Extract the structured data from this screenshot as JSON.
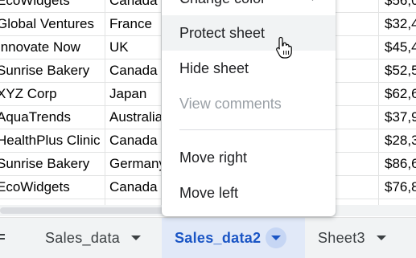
{
  "rows": [
    {
      "name": "EcoWidgets",
      "country": "Canada",
      "amount": "$56,0"
    },
    {
      "name": "Global Ventures",
      "country": "France",
      "amount": "$32,4"
    },
    {
      "name": "Innovate Now",
      "country": "UK",
      "amount": "$45,4"
    },
    {
      "name": "Sunrise Bakery",
      "country": "Canada",
      "amount": "$52,5"
    },
    {
      "name": "XYZ Corp",
      "country": "Japan",
      "amount": "$62,6"
    },
    {
      "name": "AquaTrends",
      "country": "Australia",
      "amount": "$37,9"
    },
    {
      "name": "HealthPlus Clinic",
      "country": "Canada",
      "amount": "$28,3"
    },
    {
      "name": "Sunrise Bakery",
      "country": "Germany",
      "amount": "$86,6"
    },
    {
      "name": "EcoWidgets",
      "country": "Canada",
      "amount": "$76,8"
    }
  ],
  "context_menu": {
    "change_color": "Change color",
    "protect_sheet": "Protect sheet",
    "hide_sheet": "Hide sheet",
    "view_comments": "View comments",
    "move_right": "Move right",
    "move_left": "Move left"
  },
  "tabs": [
    {
      "label": "Sales_data"
    },
    {
      "label": "Sales_data2"
    },
    {
      "label": "Sheet3"
    }
  ],
  "colors": {
    "active_tab_text": "#1a55c5",
    "active_tab_bg": "#e1e9f8",
    "menu_hover_bg": "#f1f3f4",
    "disabled_text": "#9aa0a6"
  },
  "icons": {
    "all_sheets": "all-sheets-icon",
    "tab_dropdown": "chevron-down-icon",
    "submenu": "chevron-right-icon",
    "cursor": "hand-pointer-icon"
  }
}
